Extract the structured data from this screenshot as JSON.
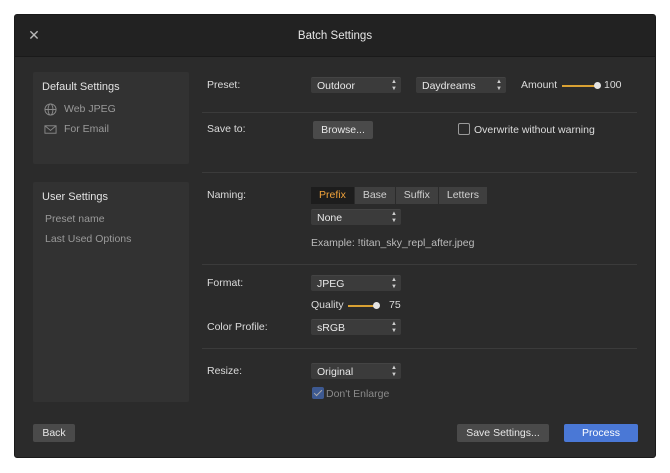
{
  "window": {
    "title": "Batch Settings",
    "close_icon": "close-icon"
  },
  "sidebar": {
    "default_settings": {
      "heading": "Default Settings",
      "items": [
        {
          "label": "Web JPEG",
          "icon": "globe-icon"
        },
        {
          "label": "For Email",
          "icon": "envelope-icon"
        }
      ]
    },
    "user_settings": {
      "heading": "User Settings",
      "items": [
        {
          "label": "Preset name"
        },
        {
          "label": "Last Used Options"
        }
      ]
    }
  },
  "preset": {
    "label": "Preset:",
    "category_value": "Outdoor",
    "style_value": "Daydreams",
    "amount_label": "Amount",
    "amount_value": "100",
    "amount_fraction": 1.0
  },
  "save_to": {
    "label": "Save to:",
    "browse_label": "Browse...",
    "overwrite_label": "Overwrite without warning",
    "overwrite_checked": false
  },
  "naming": {
    "label": "Naming:",
    "tabs": [
      "Prefix",
      "Base",
      "Suffix",
      "Letters"
    ],
    "active_tab": "Prefix",
    "value": "None",
    "example": "Example: !titan_sky_repl_after.jpeg"
  },
  "format": {
    "label": "Format:",
    "value": "JPEG",
    "quality_label": "Quality",
    "quality_value": "75",
    "quality_fraction": 0.75
  },
  "color_profile": {
    "label": "Color Profile:",
    "value": "sRGB"
  },
  "resize": {
    "label": "Resize:",
    "value": "Original",
    "dont_enlarge_label": "Don't Enlarge",
    "dont_enlarge_checked": true
  },
  "footer": {
    "back_label": "Back",
    "save_settings_label": "Save Settings...",
    "process_label": "Process"
  },
  "colors": {
    "accent": "#4a78d6",
    "tab_active_text": "#f0a23a",
    "slider": "#d9a133"
  }
}
